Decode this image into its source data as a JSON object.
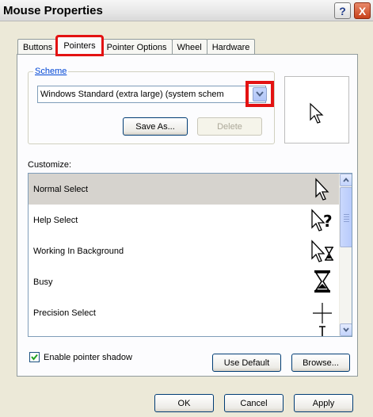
{
  "window": {
    "title": "Mouse Properties",
    "help_button": "?",
    "close_button": "X"
  },
  "tabs": [
    {
      "label": "Buttons"
    },
    {
      "label": "Pointers",
      "active": true,
      "highlighted": true
    },
    {
      "label": "Pointer Options"
    },
    {
      "label": "Wheel"
    },
    {
      "label": "Hardware"
    }
  ],
  "scheme": {
    "group_label": "Scheme",
    "selected_value": "Windows Standard (extra large) (system schem",
    "dropdown_arrow_highlighted": true,
    "save_as_label": "Save As...",
    "delete_label": "Delete",
    "delete_enabled": false
  },
  "preview": {
    "icon": "arrow-cursor-icon"
  },
  "customize": {
    "label": "Customize:",
    "items": [
      {
        "label": "Normal Select",
        "icon": "arrow-cursor-icon",
        "selected": true
      },
      {
        "label": "Help Select",
        "icon": "help-cursor-icon"
      },
      {
        "label": "Working In Background",
        "icon": "working-cursor-icon"
      },
      {
        "label": "Busy",
        "icon": "hourglass-cursor-icon"
      },
      {
        "label": "Precision Select",
        "icon": "crosshair-cursor-icon"
      }
    ]
  },
  "options": {
    "shadow_label": "Enable pointer shadow",
    "shadow_checked": true,
    "use_default_label": "Use Default",
    "browse_label": "Browse..."
  },
  "footer": {
    "ok_label": "OK",
    "cancel_label": "Cancel",
    "apply_label": "Apply"
  },
  "colors": {
    "highlight_red": "#e31212",
    "window_bg": "#ece9d8",
    "selected_row": "#d6d3ce",
    "group_label_blue": "#0046d5"
  }
}
